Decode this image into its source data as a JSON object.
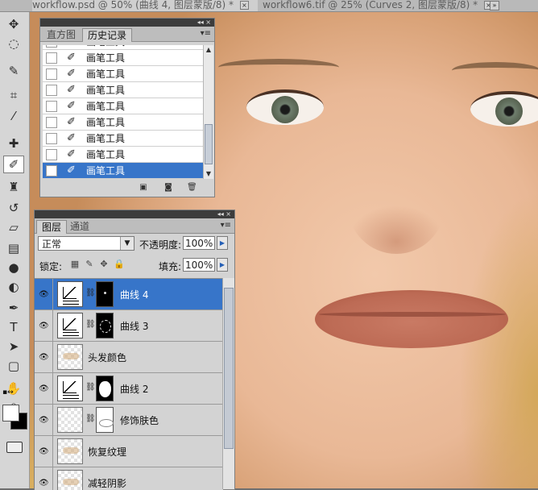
{
  "document_tabs": [
    {
      "title": "workflow.psd @ 50% (曲线 4, 图层蒙版/8) *",
      "close": "×"
    },
    {
      "title": "workflow6.tif @ 25% (Curves 2, 图层蒙版/8) *",
      "close": "×"
    }
  ],
  "tabs_overflow": "»",
  "toolbar": {
    "tools": [
      {
        "name": "move-tool",
        "glyph": "✥"
      },
      {
        "name": "marquee-tool",
        "glyph": "◌"
      },
      {
        "name": "quick-select-tool",
        "glyph": "✎"
      },
      {
        "name": "crop-tool",
        "glyph": "⌗"
      },
      {
        "name": "eyedropper-tool",
        "glyph": "⁄"
      },
      {
        "name": "healing-brush-tool",
        "glyph": "✚"
      },
      {
        "name": "brush-tool",
        "glyph": "✐"
      },
      {
        "name": "clone-stamp-tool",
        "glyph": "♜"
      },
      {
        "name": "history-brush-tool",
        "glyph": "↺"
      },
      {
        "name": "eraser-tool",
        "glyph": "▱"
      },
      {
        "name": "gradient-tool",
        "glyph": "▤"
      },
      {
        "name": "blur-tool",
        "glyph": "●"
      },
      {
        "name": "dodge-tool",
        "glyph": "◐"
      },
      {
        "name": "pen-tool",
        "glyph": "✒"
      },
      {
        "name": "type-tool",
        "glyph": "T"
      },
      {
        "name": "path-select-tool",
        "glyph": "➤"
      },
      {
        "name": "shape-tool",
        "glyph": "▢"
      },
      {
        "name": "hand-tool",
        "glyph": "✋"
      },
      {
        "name": "zoom-tool",
        "glyph": "⌕"
      }
    ],
    "swatch_mini": "▪↔",
    "foreground_color": "#ffffff",
    "background_color": "#000000"
  },
  "history_panel": {
    "tabs": [
      "直方图",
      "历史记录"
    ],
    "active_tab": "历史记录",
    "grip_buttons": "◂◂ ×",
    "menu_icon": "▾≡",
    "items": [
      {
        "label": "画笔工具"
      },
      {
        "label": "画笔工具"
      },
      {
        "label": "画笔工具"
      },
      {
        "label": "画笔工具"
      },
      {
        "label": "画笔工具"
      },
      {
        "label": "画笔工具"
      },
      {
        "label": "画笔工具"
      },
      {
        "label": "画笔工具"
      },
      {
        "label": "画笔工具",
        "selected": true
      }
    ],
    "scroll_up": "▲",
    "scroll_down": "▼",
    "footer_icons": [
      "new-document-from-state-icon",
      "snapshot-icon",
      "trash-icon"
    ]
  },
  "layers_panel": {
    "tabs": [
      "图层",
      "通道"
    ],
    "active_tab": "图层",
    "grip_buttons": "◂◂ ×",
    "menu_icon": "▾≡",
    "blend_mode": "正常",
    "opacity_label": "不透明度:",
    "opacity_value": "100%",
    "lock_label": "锁定:",
    "fill_label": "填充:",
    "fill_value": "100%",
    "layers": [
      {
        "name": "曲线 4",
        "type": "curves",
        "mask": "dot",
        "selected": true
      },
      {
        "name": "曲线 3",
        "type": "curves",
        "mask": "ring"
      },
      {
        "name": "头发颜色",
        "type": "pixel"
      },
      {
        "name": "曲线 2",
        "type": "curves",
        "mask": "blob"
      },
      {
        "name": "修饰肤色",
        "type": "pixel-masked"
      },
      {
        "name": "恢复纹理",
        "type": "pixel"
      },
      {
        "name": "减轻阴影",
        "type": "pixel"
      }
    ]
  },
  "colors": {
    "selection_blue": "#3775c9",
    "panel_gray": "#d3d3d3"
  }
}
